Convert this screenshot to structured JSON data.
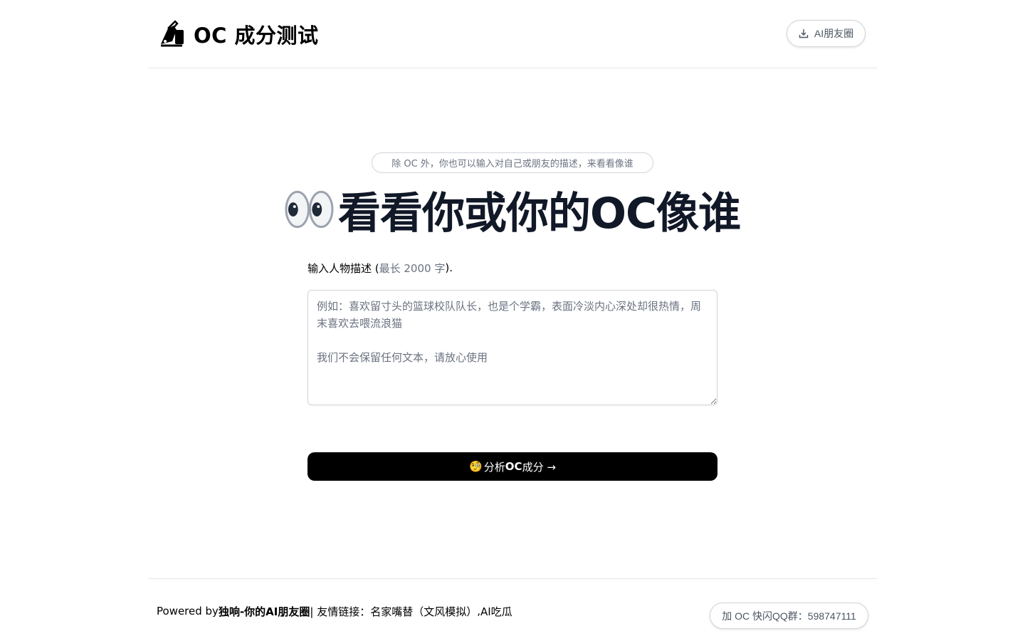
{
  "header": {
    "title": "OC 成分测试",
    "logo_icon": "writing-hand-icon",
    "moments_button": "AI朋友圈",
    "moments_icon": "download-icon"
  },
  "hero": {
    "hint": "除 OC 外，你也可以输入对自己或朋友的描述，来看看像谁",
    "headline_icon": "eyes-icon",
    "headline": "看看你或你的OC像谁"
  },
  "form": {
    "label_prefix": "输入人物描述 (",
    "label_limit": "最长 2000 字",
    "label_suffix": ").",
    "placeholder": "例如：喜欢留寸头的篮球校队队长，也是个学霸，表面冷淡内心深处却很热情，周末喜欢去喂流浪猫\n\n我们不会保留任何文本，请放心使用",
    "value": "",
    "analyze_emoji": "🧐",
    "analyze_prefix": "分析 ",
    "analyze_bold": "OC",
    "analyze_suffix": " 成分 →"
  },
  "footer": {
    "powered_by": "Powered by ",
    "brand": "独响-你的AI朋友圈",
    "separator": " | 友情链接： ",
    "link_1": "名家嘴替（文风模拟）",
    "link_sep": ",",
    "link_2": "AI吃瓜",
    "qq_button": "加 OC 快闪QQ群：598747111"
  },
  "colors": {
    "headline": "#111827",
    "muted": "#6b7280",
    "button_bg": "#000000",
    "border": "#d1d5db"
  }
}
